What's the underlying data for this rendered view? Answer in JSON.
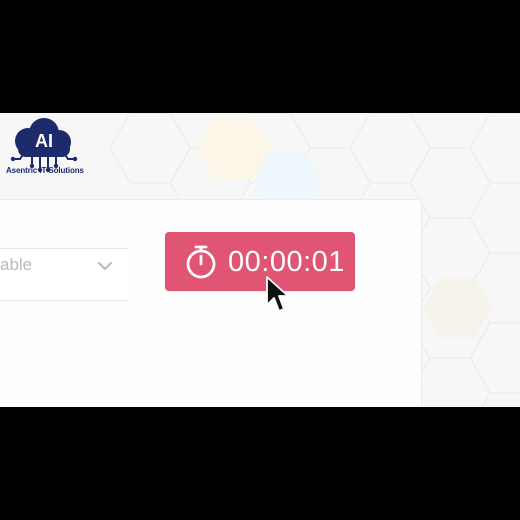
{
  "brand": {
    "logo_text": "AI",
    "company_name": "Asentric IT Solutions",
    "logo_color": "#1d2a6b"
  },
  "select": {
    "visible_text": "able",
    "icon": "chevron-down-icon"
  },
  "timer": {
    "display": "00:00:01",
    "icon": "stopwatch-icon",
    "button_color": "#e05474"
  },
  "cursor": {
    "icon": "mouse-pointer-icon"
  }
}
